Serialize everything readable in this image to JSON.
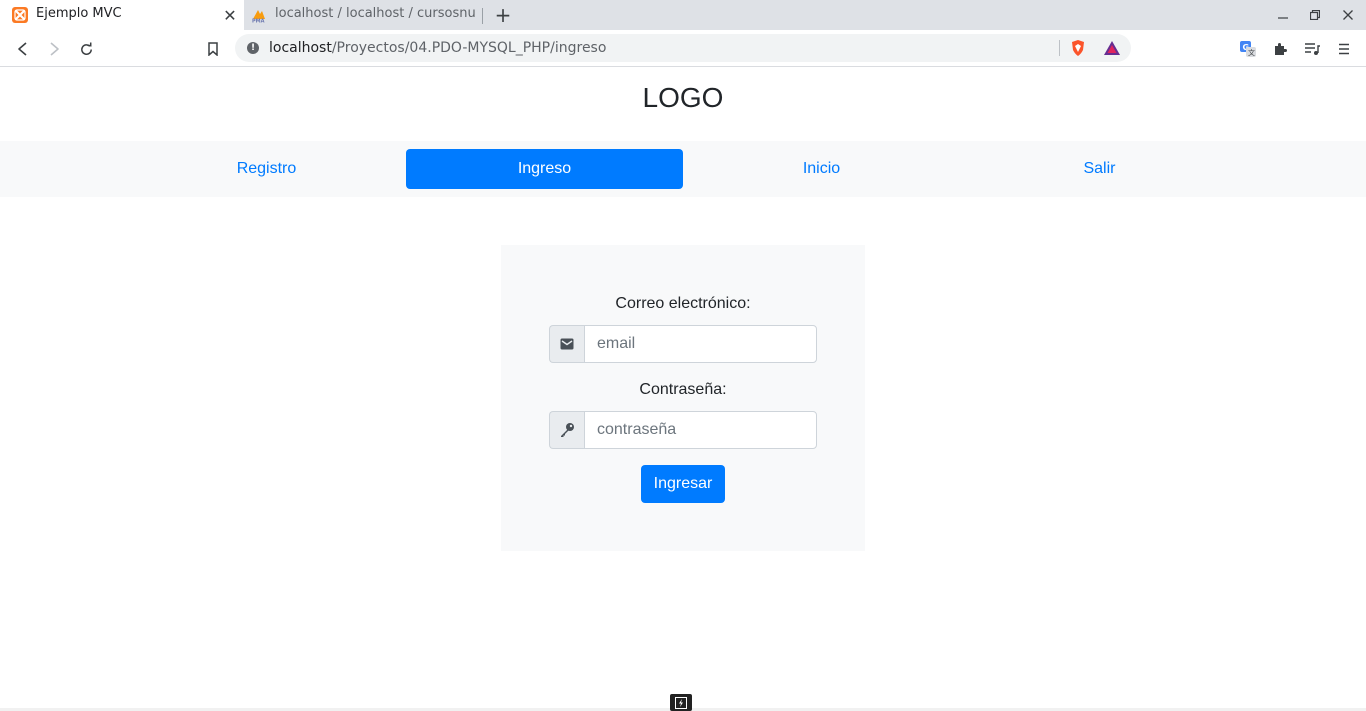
{
  "browser": {
    "tabs": [
      {
        "title": "Ejemplo MVC",
        "icon": "xampp-icon",
        "active": true
      },
      {
        "title": "localhost / localhost / cursosnu",
        "icon": "phpmyadmin-icon",
        "active": false
      }
    ],
    "url_host": "localhost",
    "url_path": "/Proyectos/04.PDO-MYSQL_PHP/ingreso"
  },
  "page": {
    "logo": "LOGO",
    "nav": [
      {
        "label": "Registro",
        "active": false
      },
      {
        "label": "Ingreso",
        "active": true
      },
      {
        "label": "Inicio",
        "active": false
      },
      {
        "label": "Salir",
        "active": false
      }
    ],
    "form": {
      "email_label": "Correo electrónico:",
      "email_placeholder": "email",
      "password_label": "Contraseña:",
      "password_placeholder": "contraseña",
      "submit_label": "Ingresar"
    }
  },
  "colors": {
    "primary": "#007bff",
    "navbar_bg": "#f8f9fa",
    "card_bg": "#f8f9fa"
  }
}
